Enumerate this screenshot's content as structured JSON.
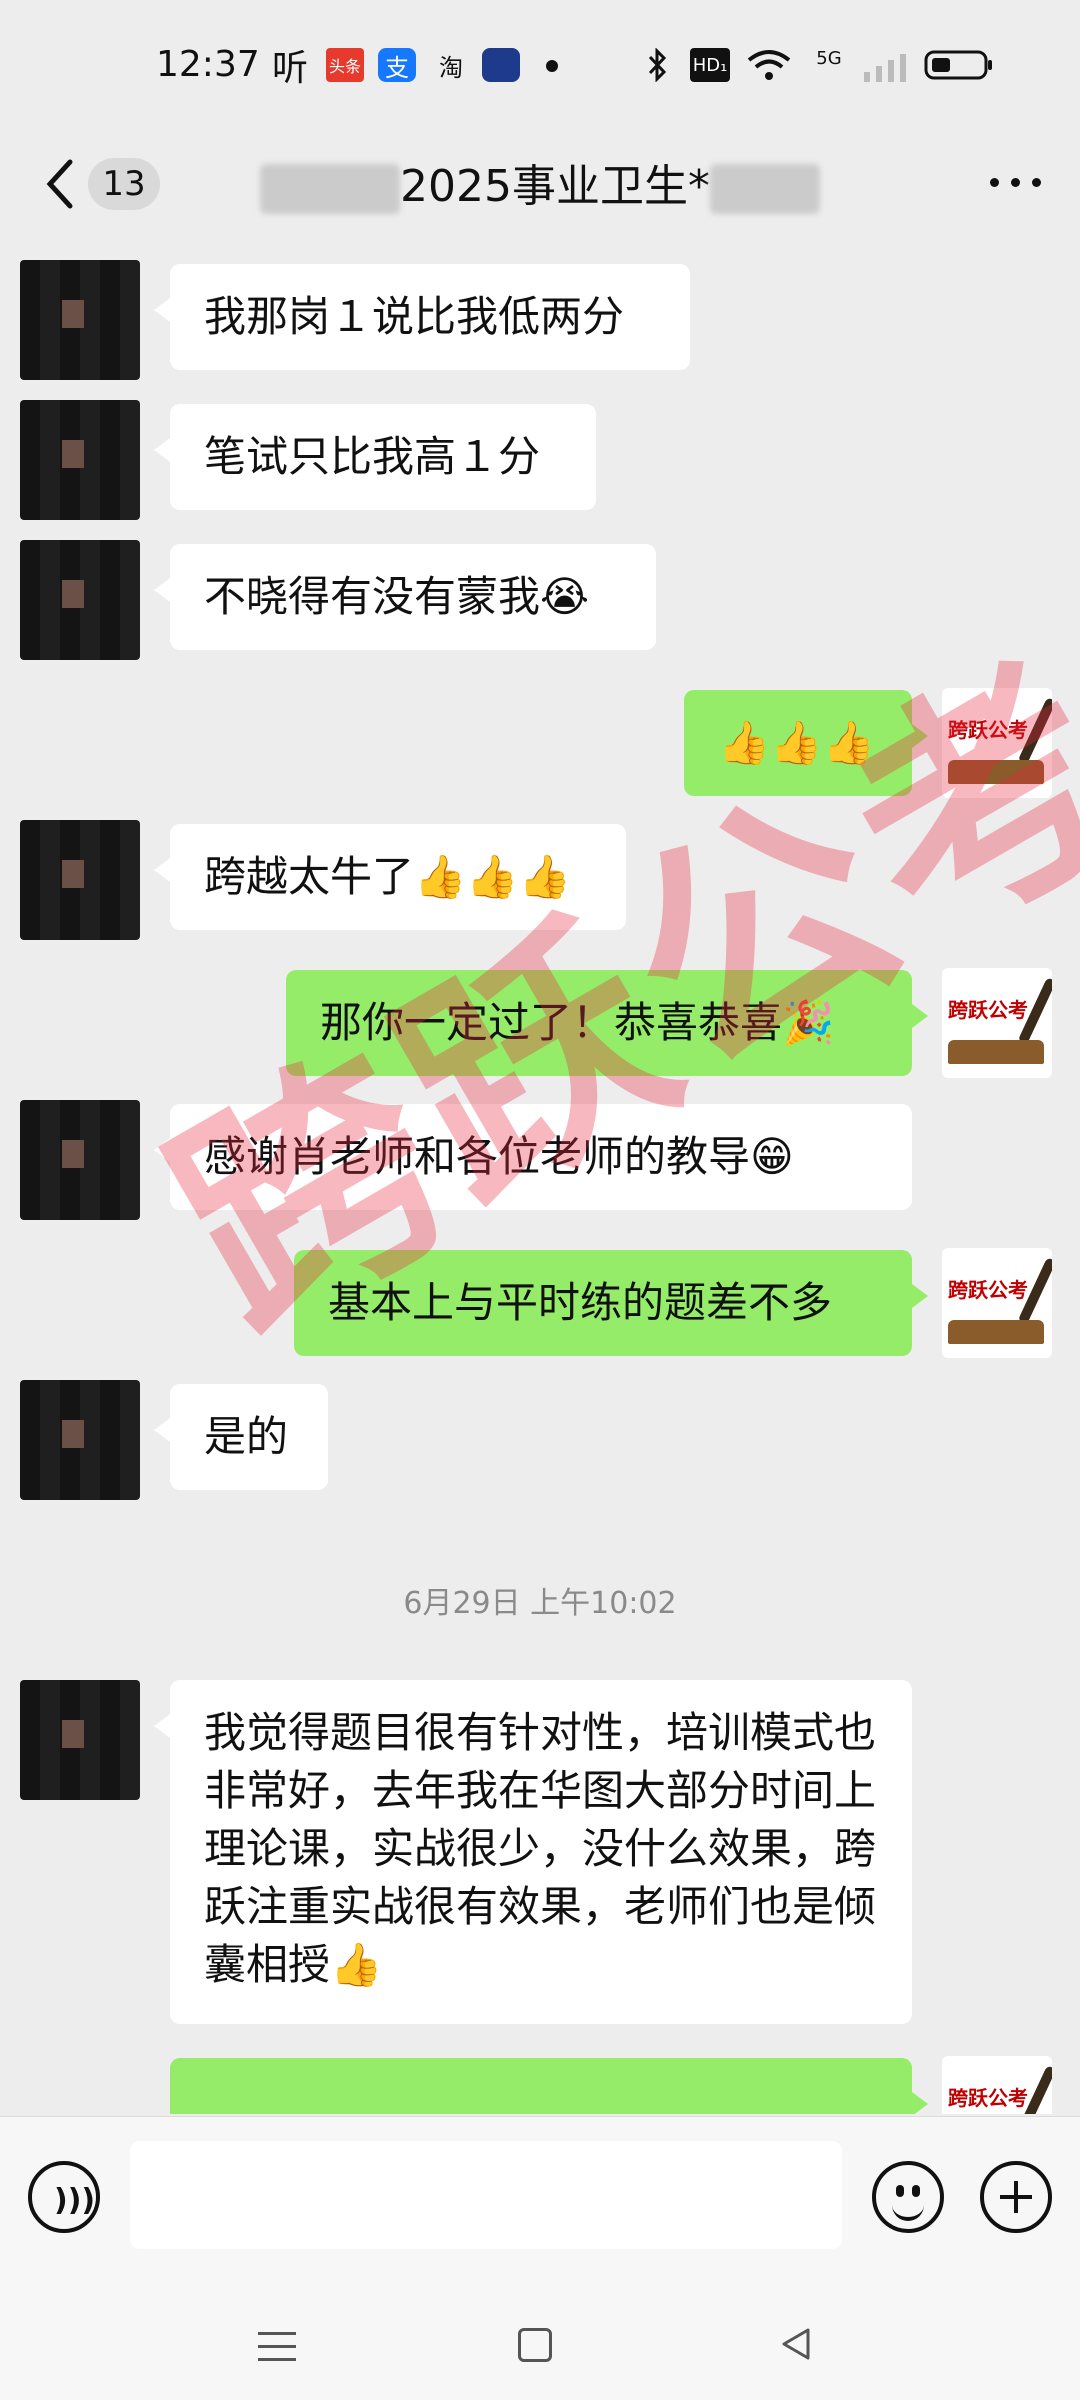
{
  "status_bar": {
    "time": "12:37",
    "icons": [
      "listen-app-icon",
      "toutiao-icon",
      "alipay-icon",
      "taobao-icon",
      "app-badge-icon",
      "dot-icon",
      "bluetooth-icon",
      "hd-icon",
      "wifi-icon",
      "5g-signal-icon",
      "signal-icon",
      "battery-icon"
    ],
    "toutiao_label": "头条",
    "alipay_label": "支",
    "taobao_label": "淘",
    "listen_label": "听",
    "hd_label": "HD₁",
    "network_label": "5G"
  },
  "header": {
    "unread_count": "13",
    "title": "2025事业卫生*",
    "more_icon": "more-dots-icon",
    "back_icon": "back-chevron-icon"
  },
  "messages": [
    {
      "side": "in",
      "text": "我那岗１说比我低两分"
    },
    {
      "side": "in",
      "text": "笔试只比我高１分"
    },
    {
      "side": "in",
      "text": "不晓得有没有蒙我😭"
    },
    {
      "side": "out",
      "text": "👍👍👍"
    },
    {
      "side": "in",
      "text": "跨越太牛了👍👍👍"
    },
    {
      "side": "out",
      "text": "那你一定过了！恭喜恭喜🎉"
    },
    {
      "side": "in",
      "text": "感谢肖老师和各位老师的教导😁"
    },
    {
      "side": "out",
      "text": "基本上与平时练的题差不多"
    },
    {
      "side": "in",
      "text": "是的"
    },
    {
      "side": "in",
      "text": "我觉得题目很有针对性，培训模式也非常好，去年我在华图大部分时间上理论课，实战很少，没什么效果，跨跃注重实战很有效果，老师们也是倾囊相授👍"
    },
    {
      "side": "out",
      "text": ""
    }
  ],
  "timestamp": "6月29日 上午10:02",
  "avatar_logo_text": "跨跃公考",
  "watermark": "跨跃公考",
  "input": {
    "placeholder": ""
  },
  "colors": {
    "outgoing_bubble": "#95ec69",
    "incoming_bubble": "#ffffff",
    "background": "#ededed",
    "watermark": "#eb283c"
  }
}
